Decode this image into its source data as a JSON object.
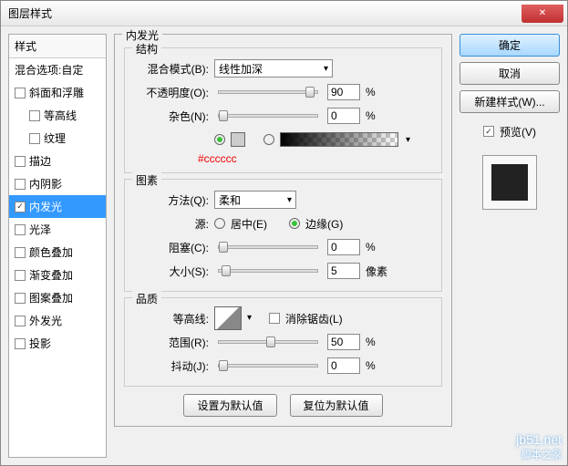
{
  "title": "图层样式",
  "left": {
    "header": "样式",
    "blend": "混合选项:自定",
    "items": [
      {
        "label": "斜面和浮雕",
        "checked": false
      },
      {
        "label": "等高线",
        "checked": false,
        "indent": true
      },
      {
        "label": "纹理",
        "checked": false,
        "indent": true
      },
      {
        "label": "描边",
        "checked": false
      },
      {
        "label": "内阴影",
        "checked": false
      },
      {
        "label": "内发光",
        "checked": true,
        "selected": true
      },
      {
        "label": "光泽",
        "checked": false
      },
      {
        "label": "颜色叠加",
        "checked": false
      },
      {
        "label": "渐变叠加",
        "checked": false
      },
      {
        "label": "图案叠加",
        "checked": false
      },
      {
        "label": "外发光",
        "checked": false
      },
      {
        "label": "投影",
        "checked": false
      }
    ]
  },
  "center": {
    "panel_title": "内发光",
    "structure": {
      "title": "结构",
      "blend_mode_label": "混合模式(B):",
      "blend_mode_value": "线性加深",
      "opacity_label": "不透明度(O):",
      "opacity_value": "90",
      "opacity_unit": "%",
      "noise_label": "杂色(N):",
      "noise_value": "0",
      "noise_unit": "%",
      "color_note": "#cccccc",
      "swatch_color": "#cccccc"
    },
    "elements": {
      "title": "图素",
      "method_label": "方法(Q):",
      "method_value": "柔和",
      "source_label": "源:",
      "source_center": "居中(E)",
      "source_edge": "边缘(G)",
      "choke_label": "阻塞(C):",
      "choke_value": "0",
      "choke_unit": "%",
      "size_label": "大小(S):",
      "size_value": "5",
      "size_unit": "像素"
    },
    "quality": {
      "title": "品质",
      "contour_label": "等高线:",
      "antialias_label": "消除锯齿(L)",
      "range_label": "范围(R):",
      "range_value": "50",
      "range_unit": "%",
      "jitter_label": "抖动(J):",
      "jitter_value": "0",
      "jitter_unit": "%"
    },
    "buttons": {
      "set_default": "设置为默认值",
      "reset_default": "复位为默认值"
    }
  },
  "right": {
    "ok": "确定",
    "cancel": "取消",
    "new_style": "新建样式(W)...",
    "preview": "预览(V)"
  },
  "watermark": {
    "main": "jb51.net",
    "sub": "脚本之家"
  }
}
